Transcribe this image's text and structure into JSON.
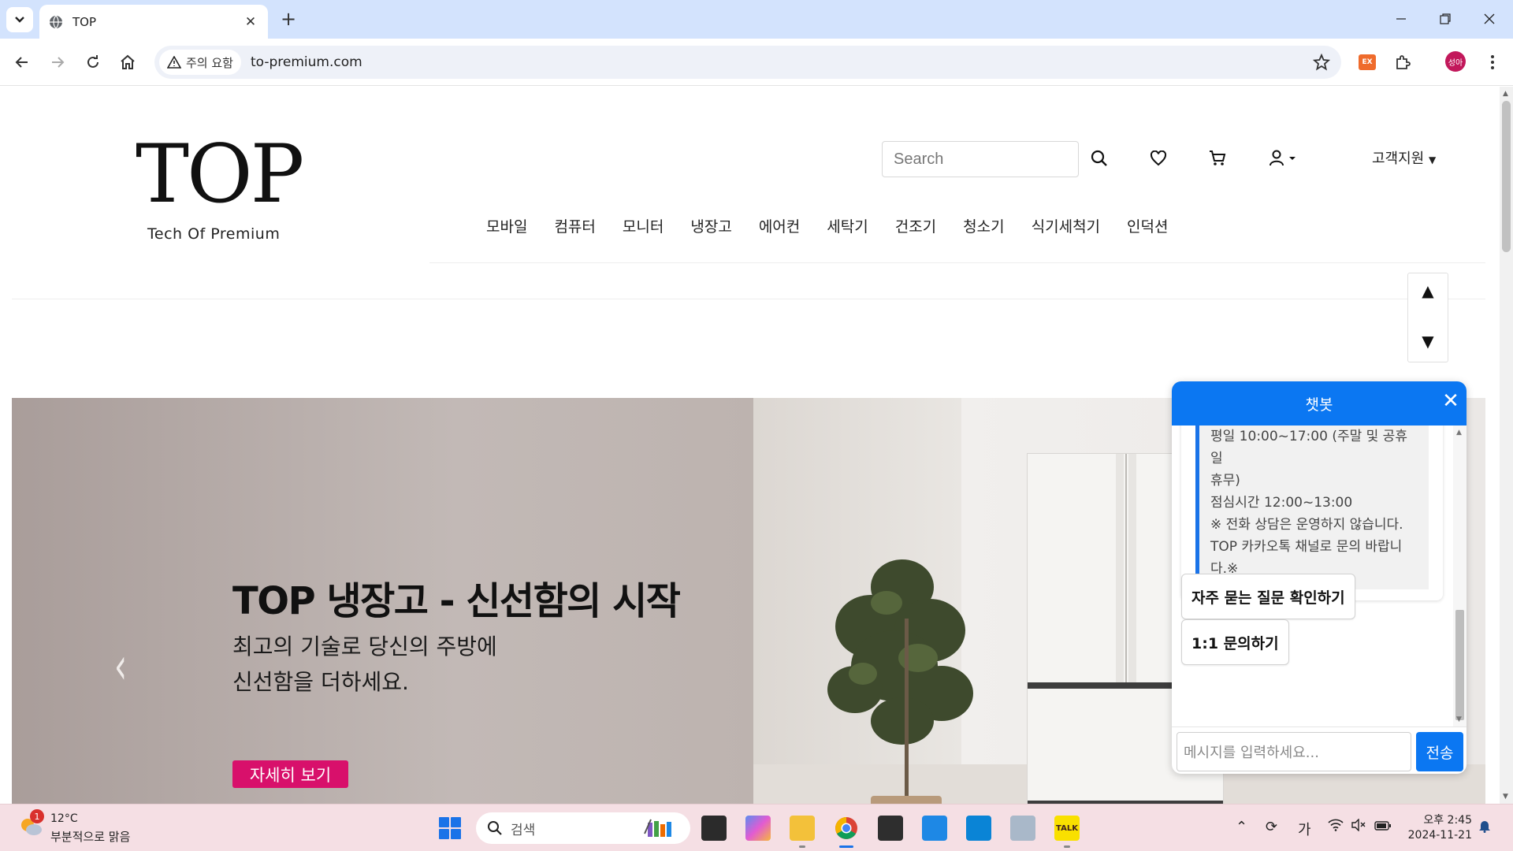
{
  "browser": {
    "tab_title": "TOP",
    "security_chip": "주의 요함",
    "url": "to-premium.com",
    "profile_initials": "성아",
    "ext_label": "EX"
  },
  "header": {
    "logo_title": "TOP",
    "logo_subtitle": "Tech Of Premium",
    "search_placeholder": "Search",
    "support_label": "고객지원"
  },
  "nav": {
    "items": [
      "모바일",
      "컴퓨터",
      "모니터",
      "냉장고",
      "에어컨",
      "세탁기",
      "건조기",
      "청소기",
      "식기세척기",
      "인덕션"
    ]
  },
  "floating": {
    "up_label": "▲",
    "down_label": "▼"
  },
  "hero": {
    "title": "TOP 냉장고 - 신선함의 시작",
    "subtitle_line1": "최고의 기술로 당신의 주방에",
    "subtitle_line2": "신선함을 더하세요.",
    "cta_label": "자세히 보기",
    "prev_label": "‹",
    "accent_color": "#d8106b"
  },
  "chatbot": {
    "title": "챗봇",
    "close_label": "✕",
    "message_lines": [
      "평일 10:00~17:00 (주말 및 공휴일",
      "휴무)",
      "점심시간 12:00~13:00",
      "※ 전화 상담은 운영하지 않습니다.",
      "TOP 카카오톡 채널로 문의 바랍니",
      "다.※"
    ],
    "buttons": [
      "자주 묻는 질문 확인하기",
      "1:1 문의하기"
    ],
    "input_placeholder": "메시지를 입력하세요...",
    "send_label": "전송",
    "header_color": "#0b77f2"
  },
  "taskbar": {
    "weather_badge": "1",
    "weather_temp": "12°C",
    "weather_desc": "부분적으로 맑음",
    "search_placeholder": "검색",
    "ime_label": "가",
    "clock_time": "오후 2:45",
    "clock_date": "2024-11-21",
    "kakao_label": "TALK"
  }
}
